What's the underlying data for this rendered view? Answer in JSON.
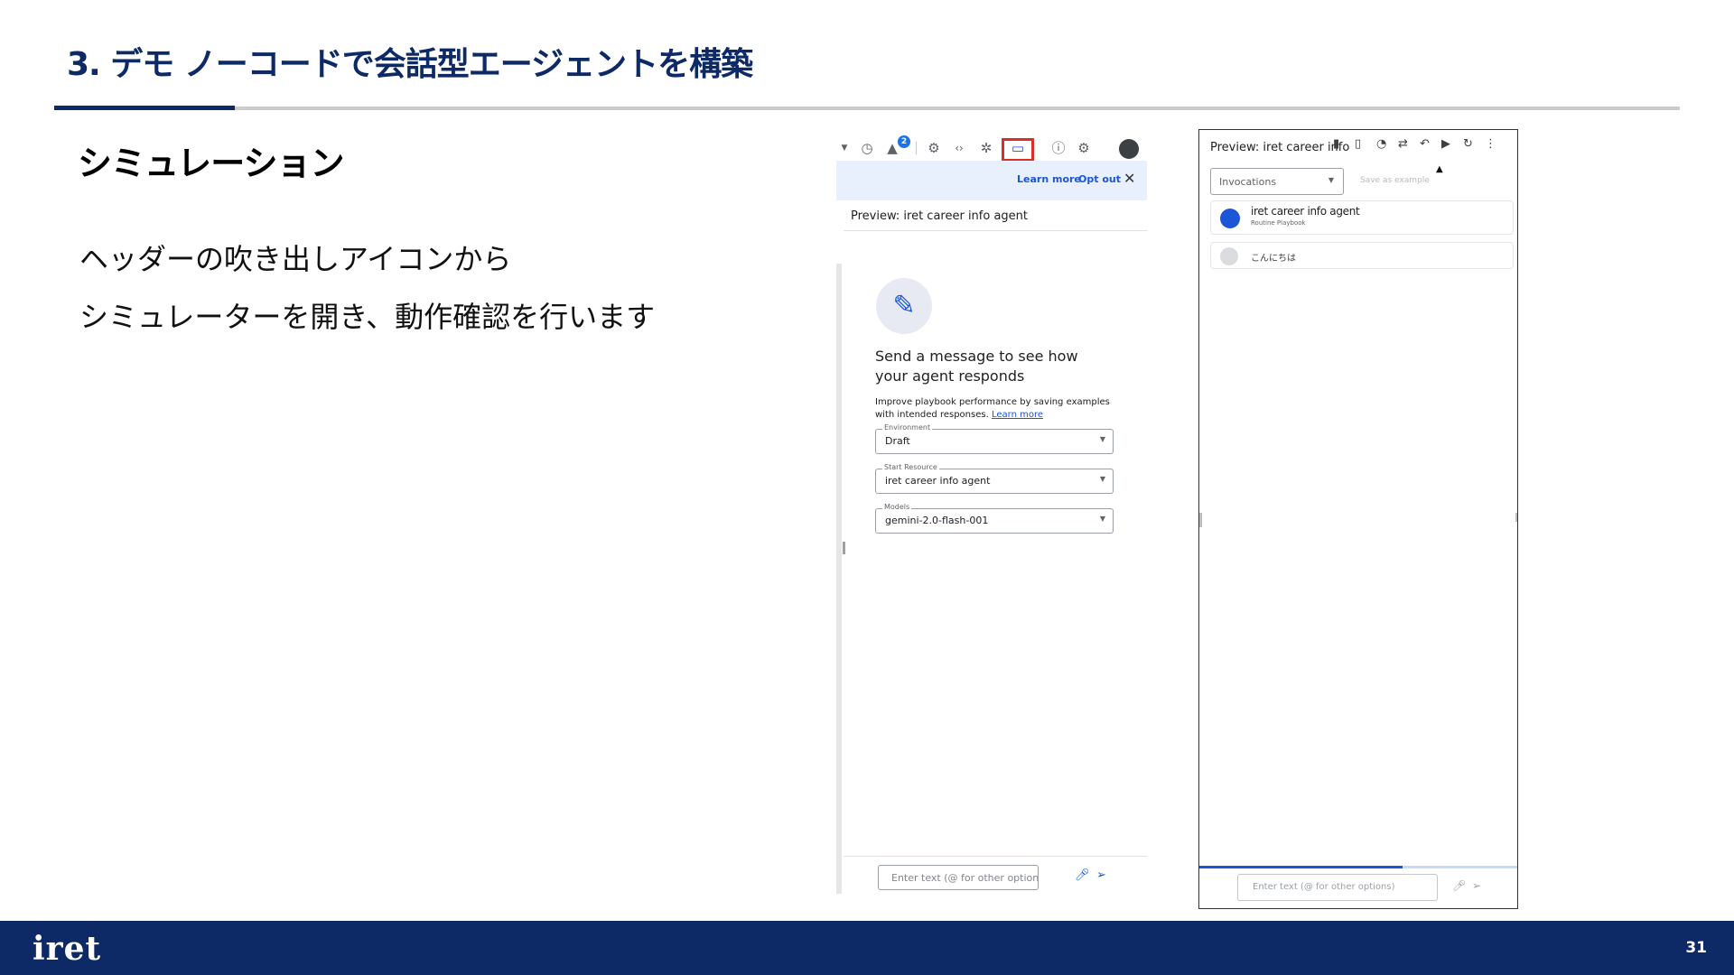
{
  "slide": {
    "title": "3. デモ ノーコードで会話型エージェントを構築",
    "section_heading": "シミュレーション",
    "body_lines": [
      "ヘッダーの吹き出しアイコンから",
      "シミュレーターを開き、動作確認を行います"
    ],
    "page_number": "31",
    "logo_text": "iret"
  },
  "left_screenshot": {
    "toolbar_icons": [
      "chevron-down-icon",
      "history-icon",
      "notification-icon",
      "settings-icon",
      "code-icon",
      "integrations-icon",
      "chat-preview-icon",
      "help-icon",
      "gear-icon",
      "avatar-icon"
    ],
    "badge_count": "2",
    "notice": {
      "learn_more": "Learn more",
      "opt_out": "Opt out"
    },
    "preview_title": "Preview: iret career info agent",
    "message_title": "Send a message to see how your agent responds",
    "help_text": "Improve playbook performance by saving examples with intended responses.",
    "help_link": "Learn more",
    "fields": [
      {
        "legend": "Environment",
        "value": "Draft"
      },
      {
        "legend": "Start Resource",
        "value": "iret career info agent"
      },
      {
        "legend": "Models",
        "value": "gemini-2.0-flash-001"
      }
    ],
    "input_placeholder": "Enter text (@ for other options)"
  },
  "right_screenshot": {
    "title": "Preview: iret career info",
    "dropdown_value": "Invocations",
    "save_as_example": "Save as example",
    "agent_name": "iret career info agent",
    "agent_type": "Routine Playbook",
    "user_message": "こんにちは",
    "input_placeholder": "Enter text (@ for other options)",
    "progress": 0.64
  },
  "colors": {
    "brand_navy": "#0d2a66",
    "highlight_red": "#d93025",
    "link_blue": "#1a56d6",
    "notice_bg": "#e8f0fe"
  }
}
